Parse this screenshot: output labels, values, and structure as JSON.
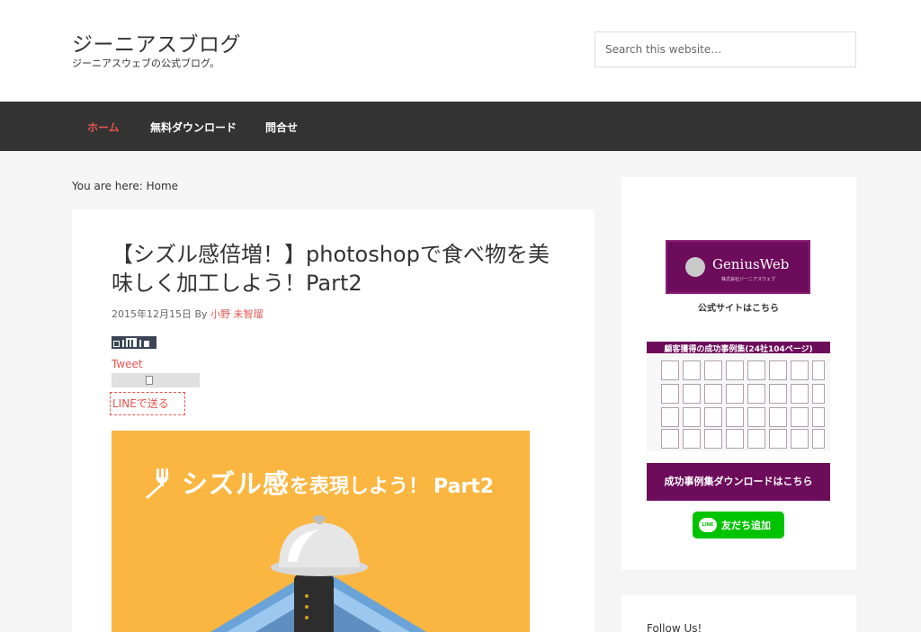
{
  "header": {
    "site_title": "ジーニアスブログ",
    "site_description": "ジーニアスウェブの公式ブログ。",
    "search_placeholder": "Search this website…"
  },
  "nav": {
    "items": [
      {
        "label": "ホーム",
        "active": true
      },
      {
        "label": "無料ダウンロード",
        "active": false
      },
      {
        "label": "問合せ",
        "active": false
      }
    ]
  },
  "breadcrumb": "You are here: Home",
  "post": {
    "title": "【シズル感倍増！】photoshopで食べ物を美味しく加工しよう！Part2",
    "date": "2015年12月15日",
    "by": "By",
    "author": "小野 未智瑠",
    "tweet": "Tweet",
    "line_share": "LINEで送る",
    "hero": {
      "text_big": "シズル感",
      "text_small": "を表現しよう！",
      "text_part": "Part2",
      "background": "#fbb641"
    }
  },
  "sidebar": {
    "genius_banner": {
      "name": "GeniusWeb",
      "sub": "株式会社ジーニアスウェブ"
    },
    "genius_caption": "公式サイトはこちら",
    "case_title": "顧客獲得の成功事例集(24社104ページ)",
    "download_button": "成功事例集ダウンロードはこちら",
    "line_badge": "LINE",
    "line_button": "友だち追加",
    "follow_title": "Follow Us!"
  },
  "colors": {
    "accent": "#e5554e",
    "nav_bg": "#333333",
    "brand_purple": "#6d0c5b",
    "line_green": "#00c300"
  }
}
